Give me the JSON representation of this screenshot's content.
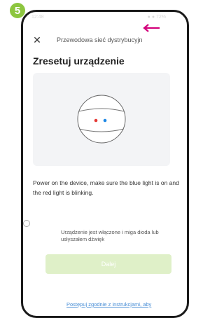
{
  "step": "5",
  "status_bar": {
    "time": "12:48",
    "icons": "● ● 72%"
  },
  "header": {
    "close_label": "✕",
    "title": "Przewodowa sieć dystrybucyjn"
  },
  "page_title": "Zresetuj urządzenie",
  "instructions": "Power on the device, make sure the blue light is on and the red light is blinking.",
  "confirm_label": "Urządzenie jest włączone i miga dioda lub usłyszałem dźwięk",
  "next_button": "Dalej",
  "help_link": "Postępuj zgodnie z instrukcjami, aby",
  "colors": {
    "accent": "#8dc63f",
    "arrow": "#d2007a",
    "led_red": "#e53935",
    "led_blue": "#1e88e5",
    "link": "#4a8fd6"
  }
}
